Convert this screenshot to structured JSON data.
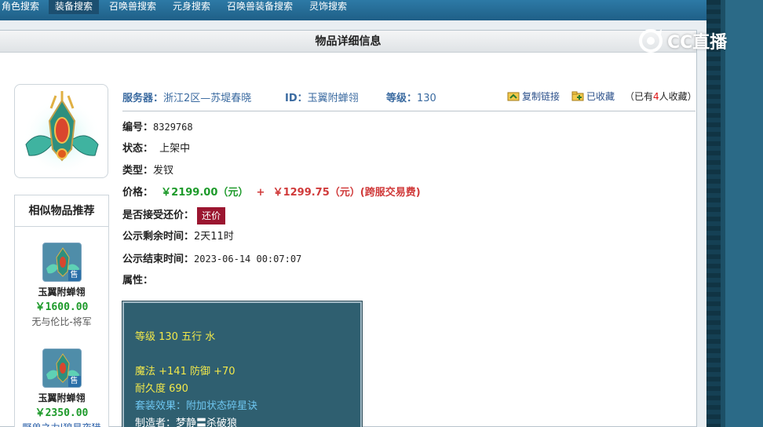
{
  "nav": {
    "tabs": [
      {
        "label": "角色搜索",
        "active": false
      },
      {
        "label": "装备搜索",
        "active": true
      },
      {
        "label": "召唤兽搜索",
        "active": false
      },
      {
        "label": "元身搜索",
        "active": false
      },
      {
        "label": "召唤兽装备搜索",
        "active": false
      },
      {
        "label": "灵饰搜索",
        "active": false
      }
    ]
  },
  "panel": {
    "title": "物品详细信息"
  },
  "watermark": {
    "text": "CC直播"
  },
  "item": {
    "server_label": "服务器：",
    "server_value": "浙江2区—苏堤春晓",
    "id_label": "ID：",
    "id_value": "玉翼附蝉翎",
    "level_label": "等级：",
    "level_value": "130",
    "copy_link": "复制链接",
    "favorited": "已收藏",
    "fav_count_prefix": "（已有",
    "fav_count": "4",
    "fav_count_suffix": "人收藏）",
    "rows": {
      "number_label": "编号：",
      "number_value": "8329768",
      "status_label": "状态：",
      "status_value": "上架中",
      "type_label": "类型：",
      "type_value": "发钗",
      "price_label": "价格：",
      "price_value": "￥2199.00（元）",
      "plus": "+",
      "fee_value": "￥1299.75（元）(跨服交易费)",
      "counter_label": "是否接受还价：",
      "counter_button": "还价",
      "remaining_label": "公示剩余时间：",
      "remaining_value": "2天11时",
      "end_label": "公示结束时间：",
      "end_value": "2023-06-14 00:07:07",
      "attr_label": "属性："
    },
    "attributes": {
      "line1": "等级 130  五行 水",
      "line2": "魔法 +141 防御 +70",
      "line3": "耐久度 690",
      "line4": "套装效果：附加状态碎星诀",
      "line5": "制造者：梦静〓杀破狼"
    }
  },
  "similar": {
    "title": "相似物品推荐",
    "items": [
      {
        "name": "玉翼附蝉翎",
        "price": "￥1600.00",
        "sub": "无与伦比-将军",
        "badge": "售"
      },
      {
        "name": "玉翼附蝉翎",
        "price": "￥2350.00",
        "sub": "野兽之力|狼星夜猎",
        "badge": "售"
      }
    ]
  },
  "colors": {
    "accent": "#2d7aa6",
    "price": "#1d9a2a",
    "fee": "#d03a3a",
    "button": "#9b1630",
    "attr_bg": "#2f5f70"
  }
}
